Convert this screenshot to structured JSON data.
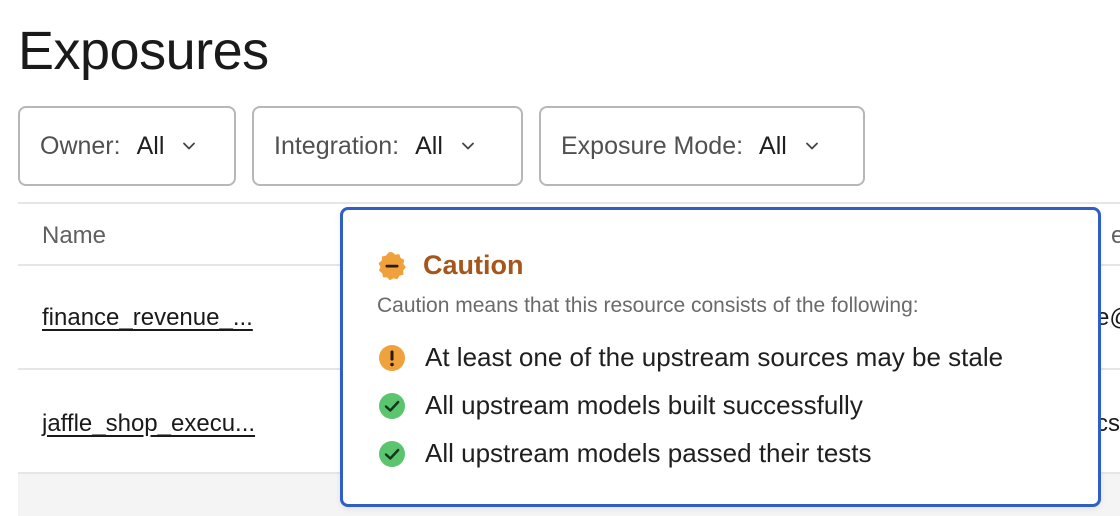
{
  "page": {
    "title": "Exposures"
  },
  "filters": [
    {
      "label": "Owner:",
      "value": "All"
    },
    {
      "label": "Integration:",
      "value": "All"
    },
    {
      "label": "Exposure Mode:",
      "value": "All"
    }
  ],
  "table": {
    "headers": {
      "name": "Name",
      "edge": "e"
    },
    "rows": [
      {
        "name": "finance_revenue_...",
        "edge": "e@"
      },
      {
        "name": "jaffle_shop_execu...",
        "edge": "cs"
      }
    ]
  },
  "tooltip": {
    "title": "Caution",
    "description": "Caution means that this resource consists of the following:",
    "items": [
      {
        "text": "At least one of the upstream sources may be stale",
        "status": "warning"
      },
      {
        "text": "All upstream models built successfully",
        "status": "success"
      },
      {
        "text": "All upstream models passed their tests",
        "status": "success"
      }
    ]
  },
  "colors": {
    "caution": "#efa13c",
    "success": "#5bc46f",
    "tooltip_border": "#2f5fc4",
    "caution_title": "#a4561c"
  }
}
